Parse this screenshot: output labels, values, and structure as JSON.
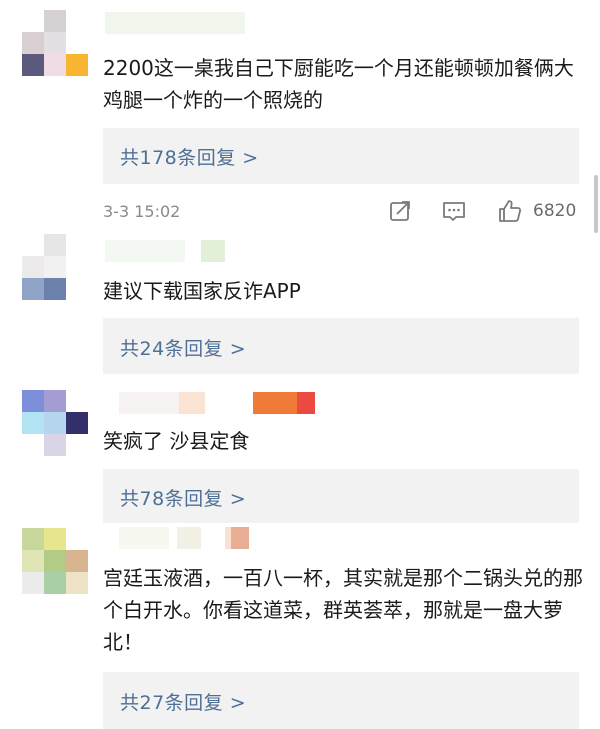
{
  "comments": [
    {
      "text": "2200这一桌我自己下厨能吃一个月还能顿顿加餐俩大鸡腿一个炸的一个照烧的",
      "reply_label": "共178条回复 >",
      "time": "3-3 15:02",
      "likes": "6820",
      "icons": [
        "share-icon",
        "comment-icon",
        "like-icon"
      ]
    },
    {
      "text": "建议下载国家反诈APP",
      "reply_label": "共24条回复 >"
    },
    {
      "text": "笑疯了 沙县定食",
      "reply_label": "共78条回复 >"
    },
    {
      "text": "宫廷玉液酒，一百八一杯，其实就是那个二锅头兑的那个白开水。你看这道菜，群英荟萃，那就是一盘大萝北！",
      "reply_label": "共27条回复 >"
    }
  ],
  "colors": {
    "link": "#4f6f97",
    "reply_bg": "#f2f2f2",
    "meta_text": "#8a8a8a"
  }
}
